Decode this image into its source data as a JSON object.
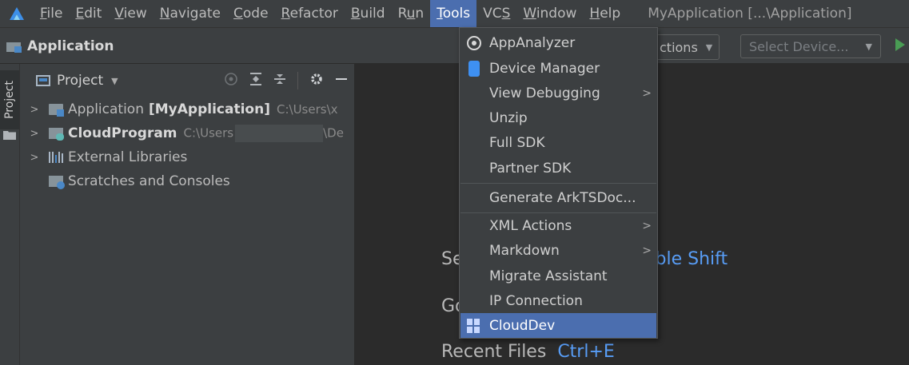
{
  "menubar": {
    "items": [
      {
        "pre": "",
        "mn": "F",
        "post": "ile"
      },
      {
        "pre": "",
        "mn": "E",
        "post": "dit"
      },
      {
        "pre": "",
        "mn": "V",
        "post": "iew"
      },
      {
        "pre": "",
        "mn": "N",
        "post": "avigate"
      },
      {
        "pre": "",
        "mn": "C",
        "post": "ode"
      },
      {
        "pre": "",
        "mn": "R",
        "post": "efactor"
      },
      {
        "pre": "",
        "mn": "B",
        "post": "uild"
      },
      {
        "pre": "R",
        "mn": "u",
        "post": "n"
      },
      {
        "pre": "",
        "mn": "T",
        "post": "ools"
      },
      {
        "pre": "VC",
        "mn": "S",
        "post": ""
      },
      {
        "pre": "",
        "mn": "W",
        "post": "indow"
      },
      {
        "pre": "",
        "mn": "H",
        "post": "elp"
      }
    ],
    "window_title": "MyApplication [...\\Application]"
  },
  "toolbar": {
    "breadcrumb": "Application",
    "actions_label": "ctions",
    "device_placeholder": "Select Device...",
    "dropdown_glyph": "▼"
  },
  "stripe": {
    "project_tab": "Project"
  },
  "project_panel": {
    "title": "Project",
    "dropdown_glyph": "▼",
    "tree": [
      {
        "name": "Application",
        "bold": "[MyApplication]",
        "path": "C:\\Users\\x"
      },
      {
        "name": "CloudProgram",
        "path_start": "C:\\Users",
        "path_end": "\\De"
      },
      {
        "name": "External Libraries"
      },
      {
        "name": "Scratches and Consoles"
      }
    ],
    "chevron": ">"
  },
  "editor": {
    "hints": [
      {
        "text": "Se",
        "key": "ble Shift"
      },
      {
        "text": "Go",
        "key": ""
      },
      {
        "text": "Recent Files",
        "key": "Ctrl+E"
      }
    ]
  },
  "tools_menu": {
    "items": [
      {
        "label": "AppAnalyzer",
        "icon": "analyzer-icon"
      },
      {
        "label": "Device Manager",
        "icon": "device-icon"
      },
      {
        "label": "View Debugging",
        "submenu": true
      },
      {
        "label": "Unzip"
      },
      {
        "label": "Full SDK"
      },
      {
        "label": "Partner SDK"
      },
      {
        "label": "Generate ArkTSDoc..."
      },
      {
        "label": "XML Actions",
        "submenu": true
      },
      {
        "label": "Markdown",
        "submenu": true
      },
      {
        "label": "Migrate Assistant"
      },
      {
        "label": "IP Connection"
      },
      {
        "label": "CloudDev",
        "icon": "clouddev-icon",
        "selected": true
      }
    ],
    "submenu_glyph": ">"
  },
  "colors": {
    "accent": "#4b6eaf",
    "link": "#589df6",
    "run": "#499c54"
  }
}
